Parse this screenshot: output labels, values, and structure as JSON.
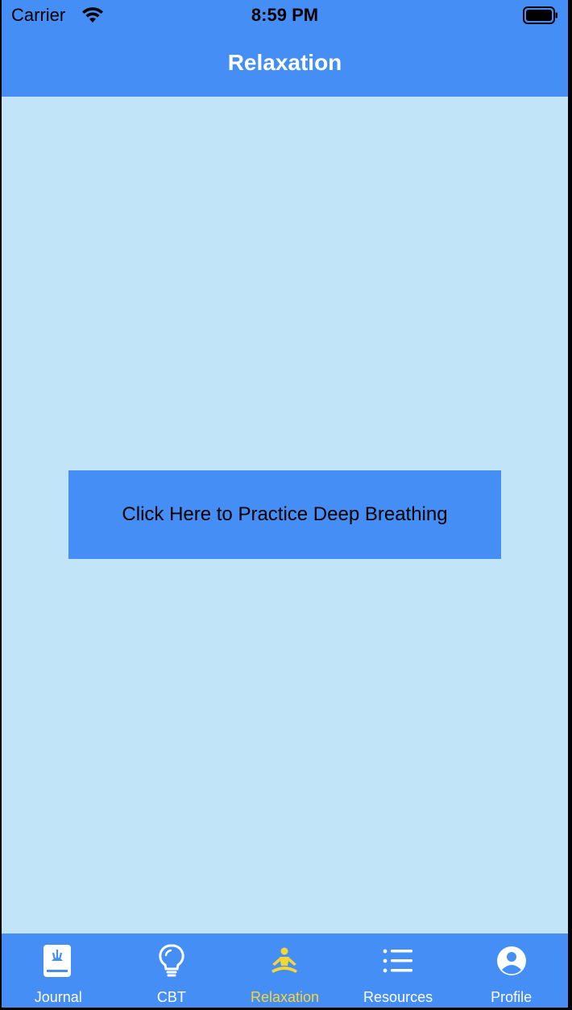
{
  "status_bar": {
    "carrier": "Carrier",
    "time": "8:59 PM"
  },
  "nav": {
    "title": "Relaxation"
  },
  "main": {
    "breathing_button_label": "Click Here to Practice Deep Breathing"
  },
  "tabs": [
    {
      "label": "Journal",
      "icon": "journal-book-icon",
      "active": false
    },
    {
      "label": "CBT",
      "icon": "lightbulb-icon",
      "active": false
    },
    {
      "label": "Relaxation",
      "icon": "meditation-icon",
      "active": true
    },
    {
      "label": "Resources",
      "icon": "list-icon",
      "active": false
    },
    {
      "label": "Profile",
      "icon": "profile-icon",
      "active": false
    }
  ],
  "colors": {
    "brand_blue": "#448ef6",
    "background": "#c2e4f9",
    "active_tab": "#f7d633",
    "tab_label": "#ffffff"
  }
}
